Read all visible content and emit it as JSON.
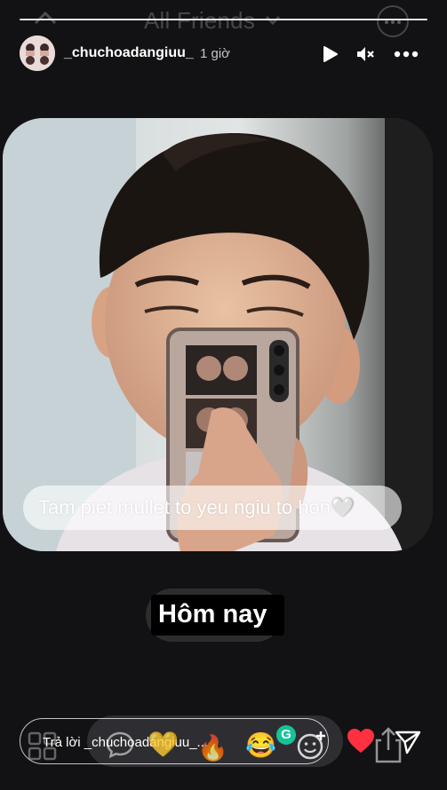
{
  "top_overlay": {
    "title": "All Friends"
  },
  "story": {
    "username": "_chuchoadangiuu_",
    "time_ago": "1 giờ",
    "caption": "Tam piet mullet to yeu ngiu to hon🤍",
    "date_label": "Hôm nay"
  },
  "reply": {
    "placeholder": "Trả lời _chuchoadangiuu_..."
  },
  "reactions": [
    "💛",
    "🔥",
    "😂"
  ],
  "grammarly_badge": "G",
  "icons": {
    "close": "chevron-up-icon",
    "play": "play-icon",
    "mute": "volume-muted-icon",
    "more": "more-dots-icon",
    "grid": "grid-icon",
    "message": "chat-bubble-icon",
    "add_emoji": "add-emoji-icon",
    "like": "heart-icon",
    "share": "share-icon",
    "send": "send-icon"
  },
  "colors": {
    "background": "#121214",
    "heart": "#ff3040",
    "grammarly": "#15c39a"
  }
}
